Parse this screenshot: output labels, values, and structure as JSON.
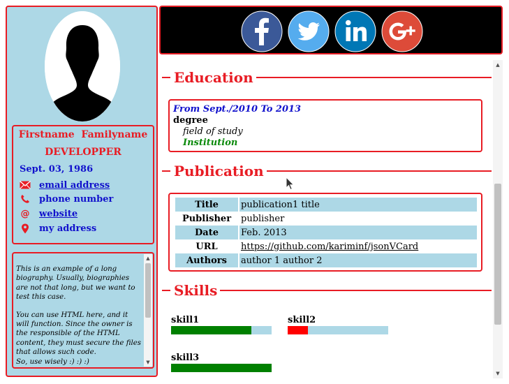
{
  "profile": {
    "name": "Firstname  Familyname",
    "title": "DEVELOPPER",
    "birth_date": "Sept. 03, 1986",
    "email": "email address",
    "phone": "phone number",
    "website": "website",
    "address": "my address",
    "bio": [
      "This is an example of a long biography. Usually, biographies are not that long, but we want to test this case.",
      "You can use HTML here, and it will function. Since the owner is the responsible of the HTML content, they must secure the files that allows such code.",
      "So, use wisely :) :) :)"
    ]
  },
  "social": [
    {
      "name": "facebook",
      "color": "#3b5998"
    },
    {
      "name": "twitter",
      "color": "#55acee"
    },
    {
      "name": "linkedin",
      "color": "#0077b5"
    },
    {
      "name": "google-plus",
      "color": "#dd4b39"
    }
  ],
  "sections": {
    "education": "Education",
    "publication": "Publication",
    "skills": "Skills"
  },
  "education": {
    "period": "From Sept./2010 To 2013",
    "degree": "degree",
    "field": "field of study",
    "institution": "Institution"
  },
  "publication": [
    {
      "key": "Title",
      "value": "publication1 title"
    },
    {
      "key": "Publisher",
      "value": "publisher"
    },
    {
      "key": "Date",
      "value": "Feb. 2013"
    },
    {
      "key": "URL",
      "value": "https://github.com/kariminf/jsonVCard"
    },
    {
      "key": "Authors",
      "value": "author 1 author 2"
    }
  ],
  "skills": [
    {
      "name": "skill1",
      "level": 0.8,
      "color": "#008000"
    },
    {
      "name": "skill2",
      "level": 0.2,
      "color": "#ff0000"
    },
    {
      "name": "skill3",
      "level": 1.0,
      "color": "#008000"
    }
  ],
  "colors": {
    "accent": "#e81c24",
    "sidebar_bg": "#add8e6",
    "link": "#1111cc"
  }
}
